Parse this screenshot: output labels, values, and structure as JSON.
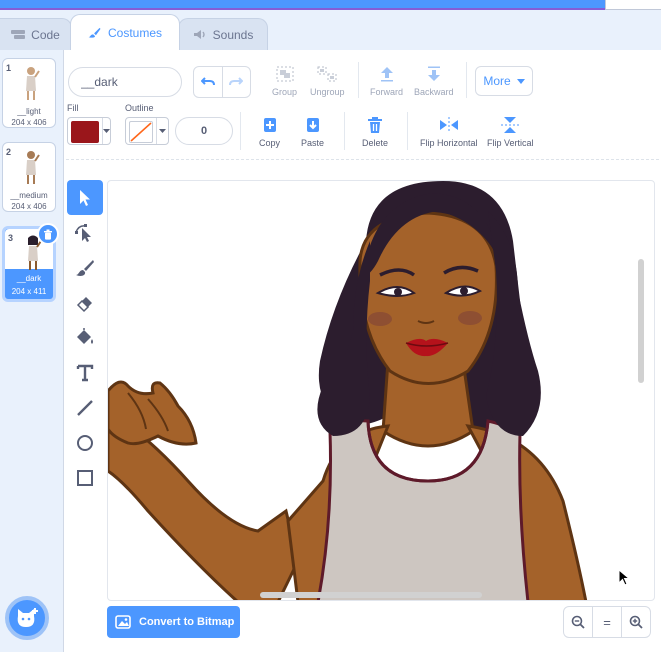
{
  "tabs": [
    {
      "label": "Code",
      "icon": "code-icon"
    },
    {
      "label": "Costumes",
      "icon": "brush-icon"
    },
    {
      "label": "Sounds",
      "icon": "speaker-icon"
    }
  ],
  "costumes": [
    {
      "number": "1",
      "name": "__light",
      "size": "204 x 406"
    },
    {
      "number": "2",
      "name": "__medium",
      "size": "204 x 406"
    },
    {
      "number": "3",
      "name": "__dark",
      "size": "204 x 411"
    }
  ],
  "editor": {
    "costume_name": "__dark",
    "group_label": "Group",
    "ungroup_label": "Ungroup",
    "forward_label": "Forward",
    "backward_label": "Backward",
    "more_label": "More",
    "fill_label": "Fill",
    "outline_label": "Outline",
    "stroke_width": "0",
    "copy_label": "Copy",
    "paste_label": "Paste",
    "delete_label": "Delete",
    "flip_h_label": "Flip Horizontal",
    "flip_v_label": "Flip Vertical",
    "convert_label": "Convert to Bitmap",
    "zoom_reset_label": "="
  },
  "colors": {
    "accent": "#4c97ff",
    "fill": "#9a161b",
    "outline": "none"
  }
}
